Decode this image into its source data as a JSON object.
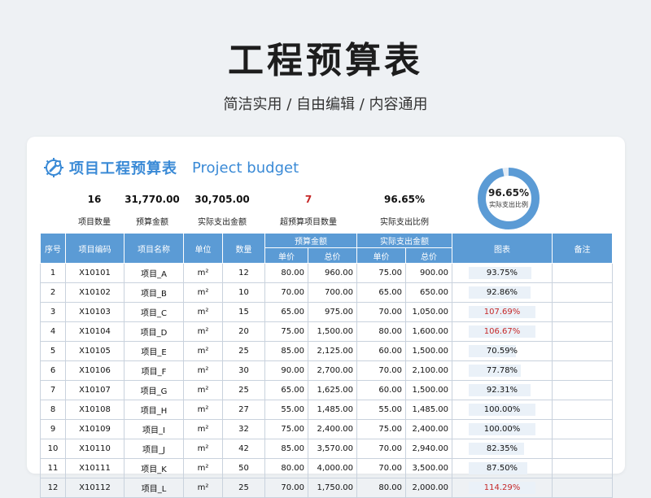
{
  "page": {
    "title": "工程预算表",
    "subtitle": "简洁实用 / 自由编辑 / 内容通用"
  },
  "card": {
    "heading_cn": "项目工程预算表",
    "heading_en": "Project budget",
    "icon": "gear-wrench-icon",
    "accent_color": "#3a8ad6"
  },
  "stats": [
    {
      "value": "16",
      "label": "项目数量"
    },
    {
      "value": "31,770.00",
      "label": "预算金额"
    },
    {
      "value": "30,705.00",
      "label": "实际支出金额"
    },
    {
      "value": "7",
      "label": "超预算项目数量"
    },
    {
      "value": "96.65%",
      "label": "实际支出比例"
    }
  ],
  "donut": {
    "value_text": "96.65%",
    "fraction": 0.9665,
    "label": "实际支出比例",
    "color": "#5b9bd5"
  },
  "table": {
    "headers": {
      "seq": "序号",
      "code": "项目编码",
      "name": "项目名称",
      "unit": "单位",
      "qty": "数量",
      "budget": "预算金额",
      "actual": "实际支出金额",
      "chart": "图表",
      "note": "备注",
      "unit_price": "单价",
      "total_price": "总价"
    },
    "header_color": "#5b9bd5",
    "over_budget_color": "#c62828",
    "rows": [
      {
        "seq": "1",
        "code": "X10101",
        "name": "项目_A",
        "unit": "m²",
        "qty": "12",
        "b_unit": "80.00",
        "b_total": "960.00",
        "a_unit": "75.00",
        "a_total": "900.00",
        "ratio": "93.75%",
        "ratio_value": 0.9375,
        "over": false,
        "note": ""
      },
      {
        "seq": "2",
        "code": "X10102",
        "name": "项目_B",
        "unit": "m²",
        "qty": "10",
        "b_unit": "70.00",
        "b_total": "700.00",
        "a_unit": "65.00",
        "a_total": "650.00",
        "ratio": "92.86%",
        "ratio_value": 0.9286,
        "over": false,
        "note": ""
      },
      {
        "seq": "3",
        "code": "X10103",
        "name": "项目_C",
        "unit": "m²",
        "qty": "15",
        "b_unit": "65.00",
        "b_total": "975.00",
        "a_unit": "70.00",
        "a_total": "1,050.00",
        "ratio": "107.69%",
        "ratio_value": 1.0769,
        "over": true,
        "note": ""
      },
      {
        "seq": "4",
        "code": "X10104",
        "name": "项目_D",
        "unit": "m²",
        "qty": "20",
        "b_unit": "75.00",
        "b_total": "1,500.00",
        "a_unit": "80.00",
        "a_total": "1,600.00",
        "ratio": "106.67%",
        "ratio_value": 1.0667,
        "over": true,
        "note": ""
      },
      {
        "seq": "5",
        "code": "X10105",
        "name": "项目_E",
        "unit": "m²",
        "qty": "25",
        "b_unit": "85.00",
        "b_total": "2,125.00",
        "a_unit": "60.00",
        "a_total": "1,500.00",
        "ratio": "70.59%",
        "ratio_value": 0.7059,
        "over": false,
        "note": ""
      },
      {
        "seq": "6",
        "code": "X10106",
        "name": "项目_F",
        "unit": "m²",
        "qty": "30",
        "b_unit": "90.00",
        "b_total": "2,700.00",
        "a_unit": "70.00",
        "a_total": "2,100.00",
        "ratio": "77.78%",
        "ratio_value": 0.7778,
        "over": false,
        "note": ""
      },
      {
        "seq": "7",
        "code": "X10107",
        "name": "项目_G",
        "unit": "m²",
        "qty": "25",
        "b_unit": "65.00",
        "b_total": "1,625.00",
        "a_unit": "60.00",
        "a_total": "1,500.00",
        "ratio": "92.31%",
        "ratio_value": 0.9231,
        "over": false,
        "note": ""
      },
      {
        "seq": "8",
        "code": "X10108",
        "name": "项目_H",
        "unit": "m²",
        "qty": "27",
        "b_unit": "55.00",
        "b_total": "1,485.00",
        "a_unit": "55.00",
        "a_total": "1,485.00",
        "ratio": "100.00%",
        "ratio_value": 1.0,
        "over": false,
        "note": ""
      },
      {
        "seq": "9",
        "code": "X10109",
        "name": "项目_I",
        "unit": "m²",
        "qty": "32",
        "b_unit": "75.00",
        "b_total": "2,400.00",
        "a_unit": "75.00",
        "a_total": "2,400.00",
        "ratio": "100.00%",
        "ratio_value": 1.0,
        "over": false,
        "note": ""
      },
      {
        "seq": "10",
        "code": "X10110",
        "name": "项目_J",
        "unit": "m²",
        "qty": "42",
        "b_unit": "85.00",
        "b_total": "3,570.00",
        "a_unit": "70.00",
        "a_total": "2,940.00",
        "ratio": "82.35%",
        "ratio_value": 0.8235,
        "over": false,
        "note": ""
      },
      {
        "seq": "11",
        "code": "X10111",
        "name": "项目_K",
        "unit": "m²",
        "qty": "50",
        "b_unit": "80.00",
        "b_total": "4,000.00",
        "a_unit": "70.00",
        "a_total": "3,500.00",
        "ratio": "87.50%",
        "ratio_value": 0.875,
        "over": false,
        "note": ""
      },
      {
        "seq": "12",
        "code": "X10112",
        "name": "项目_L",
        "unit": "m²",
        "qty": "25",
        "b_unit": "70.00",
        "b_total": "1,750.00",
        "a_unit": "80.00",
        "a_total": "2,000.00",
        "ratio": "114.29%",
        "ratio_value": 1.1429,
        "over": true,
        "note": ""
      }
    ]
  }
}
